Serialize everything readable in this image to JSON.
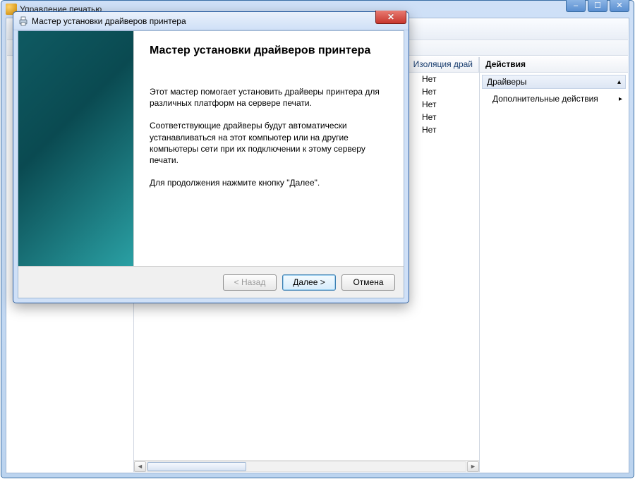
{
  "parent": {
    "title": "Управление печатью",
    "win_controls": {
      "min": "–",
      "max": "☐",
      "close": "✕"
    }
  },
  "list": {
    "col_isolation": "Изоляция драй",
    "rows": [
      {
        "isolation": "Нет"
      },
      {
        "isolation": "Нет"
      },
      {
        "isolation": "Нет"
      },
      {
        "isolation": "Нет"
      },
      {
        "isolation": "Нет"
      }
    ],
    "scroll": {
      "left": "◄",
      "right": "►"
    }
  },
  "actions": {
    "header": "Действия",
    "group": "Драйверы",
    "item_more": "Дополнительные действия"
  },
  "wizard": {
    "title": "Мастер установки драйверов принтера",
    "heading": "Мастер установки драйверов принтера",
    "p1": "Этот мастер помогает установить драйверы принтера для различных платформ на сервере печати.",
    "p2": "Соответствующие драйверы будут автоматически устанавливаться на этот компьютер или на другие компьютеры сети при их подключении к этому серверу печати.",
    "p3": "Для продолжения нажмите кнопку \"Далее\".",
    "btn_back": "< Назад",
    "btn_next": "Далее >",
    "btn_cancel": "Отмена",
    "close_glyph": "✕"
  }
}
